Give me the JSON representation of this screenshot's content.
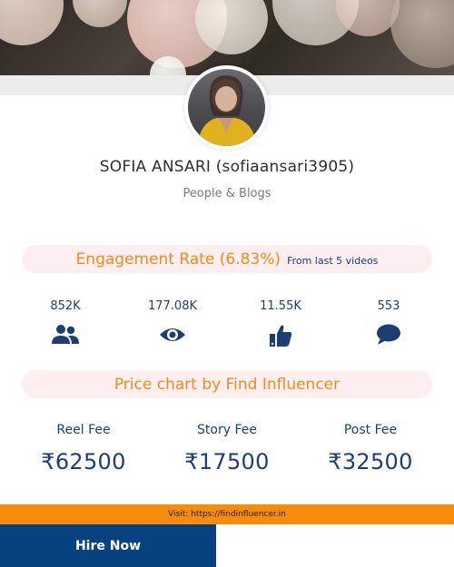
{
  "profile": {
    "name": "SOFIA ANSARI (sofiaansari3905)",
    "category": "People & Blogs"
  },
  "engagement": {
    "label": "Engagement Rate (6.83%)",
    "note": "From last 5 videos"
  },
  "stats": [
    {
      "value": "852K",
      "icon": "users-icon"
    },
    {
      "value": "177.08K",
      "icon": "eye-icon"
    },
    {
      "value": "11.55K",
      "icon": "thumbs-up-icon"
    },
    {
      "value": "553",
      "icon": "comment-icon"
    }
  ],
  "price_chart": {
    "title": "Price chart by Find Influencer"
  },
  "fees": [
    {
      "label": "Reel Fee",
      "amount": "₹62500"
    },
    {
      "label": "Story Fee",
      "amount": "₹17500"
    },
    {
      "label": "Post Fee",
      "amount": "₹32500"
    }
  ],
  "footer": {
    "visit_text": "Visit: https://findinfluencer.in",
    "hire_label": "Hire Now"
  },
  "colors": {
    "accent_orange": "#f08c16",
    "navy": "#1c3f73",
    "hire_bg": "#08417f",
    "pill_bg": "#fdeef1"
  }
}
